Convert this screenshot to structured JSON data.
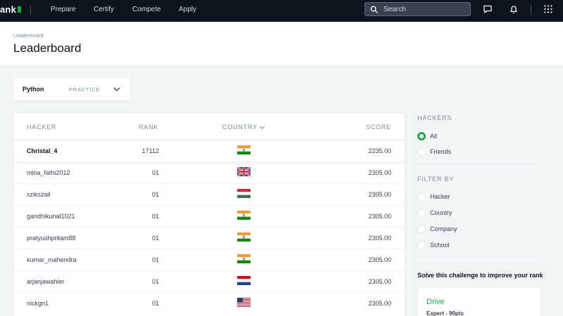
{
  "brand": {
    "logo_text": "ank",
    "accent": "#1ba94c"
  },
  "nav": {
    "links": [
      "Prepare",
      "Certify",
      "Compete",
      "Apply"
    ],
    "search_placeholder": "Search"
  },
  "header": {
    "breadcrumb": "Leaderboard",
    "title": "Leaderboard"
  },
  "selector": {
    "track": "Python",
    "kind": "PRACTICE"
  },
  "table": {
    "columns": {
      "hacker": "HACKER",
      "rank": "RANK",
      "country": "COUNTRY",
      "score": "SCORE"
    },
    "current_user": {
      "hacker": "Christal_4",
      "rank": "17112",
      "country": "india",
      "score": "2235.00"
    },
    "rows": [
      {
        "hacker": "mina_fathi2012",
        "rank": "01",
        "country": "uk",
        "score": "2305.00"
      },
      {
        "hacker": "szikszail",
        "rank": "01",
        "country": "hungary",
        "score": "2305.00"
      },
      {
        "hacker": "gandhikunal1021",
        "rank": "01",
        "country": "india",
        "score": "2305.00"
      },
      {
        "hacker": "pratyushpritam88",
        "rank": "01",
        "country": "india",
        "score": "2305.00"
      },
      {
        "hacker": "kumar_mahendra",
        "rank": "01",
        "country": "india",
        "score": "2305.00"
      },
      {
        "hacker": "arjanjawahier",
        "rank": "01",
        "country": "netherlands",
        "score": "2305.00"
      },
      {
        "hacker": "nickgn1",
        "rank": "01",
        "country": "usa",
        "score": "2305.00"
      }
    ]
  },
  "sidebar": {
    "hackers_title": "HACKERS",
    "hackers_options": [
      {
        "label": "All",
        "selected": true
      },
      {
        "label": "Friends",
        "selected": false
      }
    ],
    "filter_title": "FILTER BY",
    "filter_options": [
      "Hacker",
      "Country",
      "Company",
      "School"
    ],
    "improve_text": "Solve this challenge to improve your rank",
    "challenge": {
      "name": "Drive",
      "meta": "Expert - 90pts"
    }
  }
}
